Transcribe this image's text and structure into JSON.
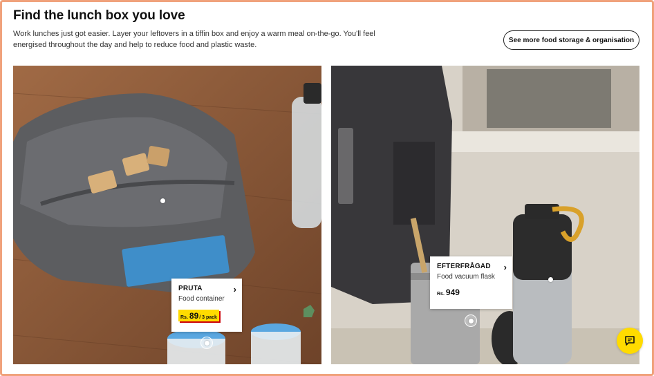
{
  "section": {
    "title": "Find the lunch box you love",
    "description": "Work lunches just got easier. Layer your leftovers in a tiffin box and enjoy a warm meal on-the-go. You'll feel energised throughout the day and help to reduce food and plastic waste.",
    "see_more_label": "See more food storage & organisation"
  },
  "products": [
    {
      "name": "PRUTA",
      "type": "Food container",
      "currency": "Rs.",
      "price": "89",
      "unit": "/ 3 pack",
      "price_style": "yellow"
    },
    {
      "name": "EFTERFRÅGAD",
      "type": "Food vacuum flask",
      "currency": "Rs.",
      "price": "949",
      "unit": "",
      "price_style": "plain"
    }
  ],
  "icons": {
    "chevron": "chevron-right-icon",
    "chat": "chat-icon"
  },
  "colors": {
    "price_highlight": "#ffdb00",
    "price_shadow": "#cc0008",
    "chat_button": "#ffdb00",
    "frame": "#f0a27c"
  }
}
